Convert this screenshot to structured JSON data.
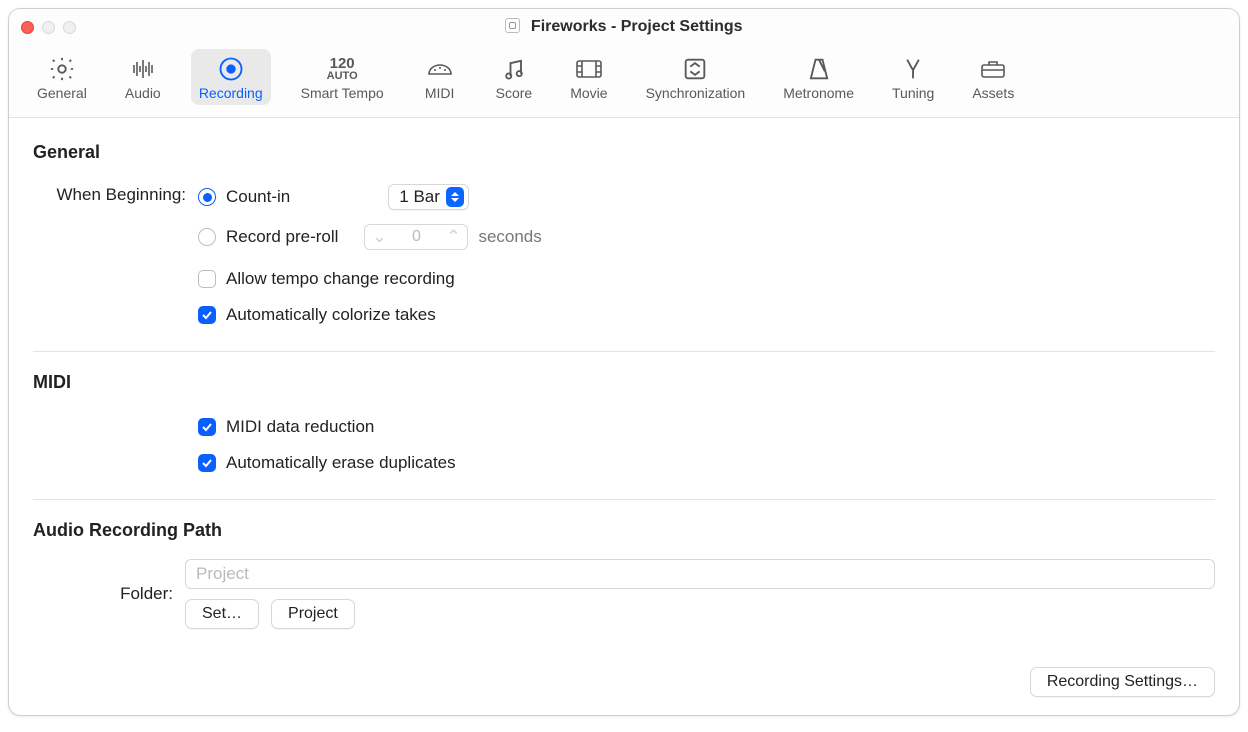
{
  "window": {
    "title": "Fireworks - Project Settings"
  },
  "tabs": {
    "general": "General",
    "audio": "Audio",
    "recording": "Recording",
    "smartTempo": "Smart Tempo",
    "midi": "MIDI",
    "score": "Score",
    "movie": "Movie",
    "sync": "Synchronization",
    "metronome": "Metronome",
    "tuning": "Tuning",
    "assets": "Assets",
    "selected": "recording"
  },
  "sections": {
    "general": {
      "title": "General",
      "whenBeginningLabel": "When Beginning:",
      "countIn": "Count-in",
      "countInValue": "1 Bar",
      "recordPreRoll": "Record pre-roll",
      "preRollValue": "0",
      "secondsLabel": "seconds",
      "allowTempoChange": "Allow tempo change recording",
      "autoColorize": "Automatically colorize takes"
    },
    "midi": {
      "title": "MIDI",
      "dataReduction": "MIDI data reduction",
      "eraseDuplicates": "Automatically erase duplicates"
    },
    "audioPath": {
      "title": "Audio Recording Path",
      "folderLabel": "Folder:",
      "folderPlaceholder": "Project",
      "setBtn": "Set…",
      "projectBtn": "Project"
    }
  },
  "footer": {
    "recordingSettings": "Recording Settings…"
  },
  "smartTempoIcon": {
    "top": "120",
    "bottom": "AUTO"
  }
}
